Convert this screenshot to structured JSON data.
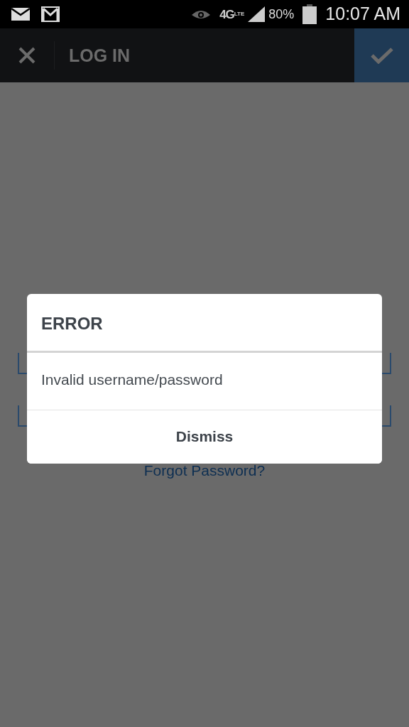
{
  "status_bar": {
    "battery": "80%",
    "time": "10:07 AM",
    "network": "4G",
    "network_sub": "LTE"
  },
  "app_bar": {
    "title": "LOG IN"
  },
  "form": {
    "forgot_link": "Forgot Password?"
  },
  "dialog": {
    "title": "ERROR",
    "message": "Invalid username/password",
    "button": "Dismiss"
  }
}
